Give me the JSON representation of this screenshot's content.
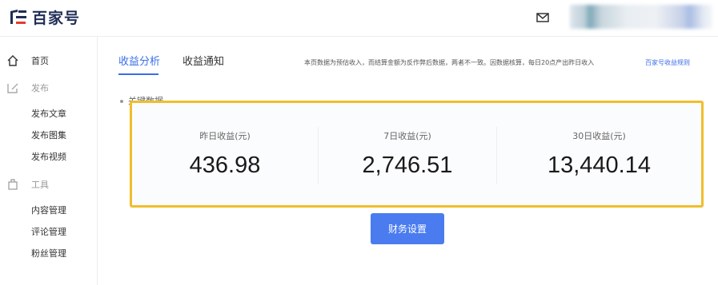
{
  "brand": {
    "name": "百家号",
    "color": "#1f2d56"
  },
  "header": {
    "mail_icon": "mail-icon"
  },
  "sidebar": {
    "home": {
      "label": "首页",
      "icon": "home-icon"
    },
    "publish": {
      "label": "发布",
      "icon": "edit-icon",
      "items": [
        "发布文章",
        "发布图集",
        "发布视频"
      ]
    },
    "tools": {
      "label": "工具",
      "icon": "toolbox-icon",
      "items": [
        "内容管理",
        "评论管理",
        "粉丝管理"
      ]
    }
  },
  "tabs": [
    {
      "label": "收益分析",
      "active": true
    },
    {
      "label": "收益通知",
      "active": false
    }
  ],
  "notice": {
    "text": "本页数据为预估收入，而结算金额为反作弊后数据，两者不一致。因数据核算，每日20点产出昨日收入",
    "link": "百家号收益规则"
  },
  "section_label": "关键数据",
  "stats": [
    {
      "label": "昨日收益(元)",
      "value": "436.98"
    },
    {
      "label": "7日收益(元)",
      "value": "2,746.51"
    },
    {
      "label": "30日收益(元)",
      "value": "13,440.14"
    }
  ],
  "finance_button": "财务设置",
  "colors": {
    "accent": "#3a6ee8",
    "highlight_border": "#f1bd2b",
    "button": "#4a7cf0"
  }
}
